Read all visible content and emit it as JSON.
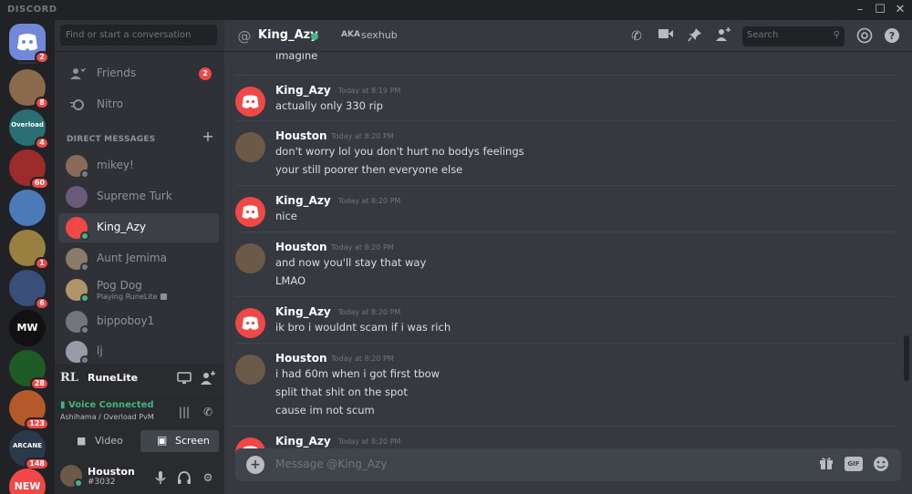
{
  "window": {
    "app_name": "DISCORD",
    "controls": [
      "minimize",
      "maximize",
      "close"
    ]
  },
  "guild_rail": {
    "home_badge": "2",
    "servers": [
      {
        "badge": "8",
        "color": "#8a6a4a"
      },
      {
        "label": "Overload",
        "badge": "4",
        "color": "#2a6f74"
      },
      {
        "badge": "60",
        "color": "#9c2c2c"
      },
      {
        "badge": "",
        "color": "#4a7ab8"
      },
      {
        "badge": "1",
        "color": "#9a8040"
      },
      {
        "badge": "6",
        "color": "#3a4f78"
      },
      {
        "label": "MW",
        "badge": "",
        "color": "#111111"
      },
      {
        "badge": "28",
        "color": "#1e5b26"
      },
      {
        "badge": "123",
        "color": "#b45a2a"
      },
      {
        "label": "ARCANE",
        "badge": "148",
        "color": "#2b3a4a"
      },
      {
        "label": "NEW",
        "badge": "",
        "color": "#f04747"
      }
    ]
  },
  "sidebar": {
    "search_placeholder": "Find or start a conversation",
    "friends_label": "Friends",
    "friends_badge": "2",
    "nitro_label": "Nitro",
    "dm_header": "DIRECT MESSAGES",
    "dms": [
      {
        "name": "mikey!",
        "status": "offline",
        "color": "#8a6a5a"
      },
      {
        "name": "Supreme Turk",
        "status": "",
        "color": "#6a5a7a"
      },
      {
        "name": "King_Azy",
        "status": "online",
        "color": "#f04747",
        "active": true
      },
      {
        "name": "Aunt Jemima",
        "status": "offline",
        "color": "#8a7a6a"
      },
      {
        "name": "Pog Dog",
        "sub": "Playing RuneLite",
        "status": "online",
        "color": "#b0956a"
      },
      {
        "name": "bippoboy1",
        "status": "offline",
        "color": "#72767d"
      },
      {
        "name": "lj",
        "status": "offline",
        "color": "#9a9aa8"
      }
    ],
    "activity_name": "RuneLite",
    "activity_logo": "RL",
    "voice_title": "Voice Connected",
    "voice_channel": "Ashihama / Overload PvM",
    "video_label": "Video",
    "screen_label": "Screen",
    "user_name": "Houston",
    "user_tag": "#3032"
  },
  "chat": {
    "recipient": "King_Azy",
    "aka_label": "AKA",
    "nickname": "sexhub",
    "search_placeholder": "Search",
    "composer_placeholder": "Message @King_Azy",
    "messages": [
      {
        "type": "continuation",
        "lines": [
          "imagine"
        ]
      },
      {
        "author": "King_Azy",
        "time": "Today at 8:19 PM",
        "lines": [
          "actually only 330 rip"
        ],
        "avatar": "discord-red"
      },
      {
        "author": "Houston",
        "time": "Today at 8:20 PM",
        "lines": [
          "don't worry lol you don't hurt no bodys feelings",
          "your still poorer then everyone else"
        ],
        "avatar": "houston"
      },
      {
        "author": "King_Azy",
        "time": "Today at 8:20 PM",
        "lines": [
          "nice"
        ],
        "avatar": "discord-red"
      },
      {
        "author": "Houston",
        "time": "Today at 8:20 PM",
        "lines": [
          "and now you'll stay that way",
          "LMAO"
        ],
        "avatar": "houston"
      },
      {
        "author": "King_Azy",
        "time": "Today at 8:20 PM",
        "lines": [
          "ik bro i wouldnt scam if i was rich"
        ],
        "avatar": "discord-red"
      },
      {
        "author": "Houston",
        "time": "Today at 8:20 PM",
        "lines": [
          "i had 60m when i got first tbow",
          "split that shit on the spot",
          "cause im not scum"
        ],
        "avatar": "houston"
      },
      {
        "author": "King_Azy",
        "time": "Today at 8:20 PM",
        "lines": [],
        "avatar": "discord-red"
      }
    ]
  },
  "colors": {
    "blurple": "#7289da",
    "online": "#43b581",
    "badge_red": "#f04747",
    "chat_bg": "#36393f",
    "sidebar_bg": "#2f3136",
    "rail_bg": "#202225"
  }
}
